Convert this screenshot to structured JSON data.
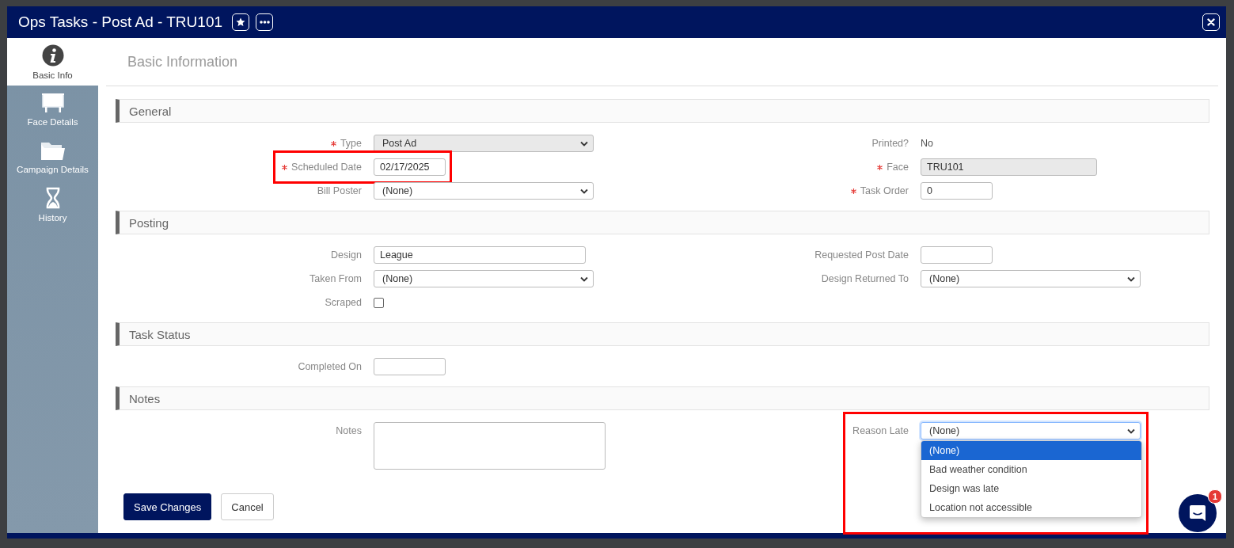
{
  "window": {
    "title": "Ops Tasks - Post Ad - TRU101"
  },
  "sidebar": {
    "items": [
      {
        "label": "Basic Info",
        "selected": true
      },
      {
        "label": "Face Details",
        "selected": false
      },
      {
        "label": "Campaign Details",
        "selected": false
      },
      {
        "label": "History",
        "selected": false
      }
    ]
  },
  "page_title": "Basic Information",
  "sections": [
    {
      "title": "General",
      "left": [
        {
          "label": "Type",
          "required": true,
          "kind": "select",
          "value": "Post Ad",
          "disabled": true
        },
        {
          "label": "Scheduled Date",
          "required": true,
          "kind": "date",
          "value": "02/17/2025",
          "highlighted": true
        },
        {
          "label": "Bill Poster",
          "required": false,
          "kind": "select",
          "value": "(None)",
          "disabled": false
        }
      ],
      "right": [
        {
          "label": "Printed?",
          "required": false,
          "kind": "plain",
          "value": "No"
        },
        {
          "label": "Face",
          "required": true,
          "kind": "readonly",
          "value": "TRU101"
        },
        {
          "label": "Task Order",
          "required": true,
          "kind": "date",
          "value": "0"
        }
      ]
    },
    {
      "title": "Posting",
      "left": [
        {
          "label": "Design",
          "required": false,
          "kind": "text",
          "value": "League"
        },
        {
          "label": "Taken From",
          "required": false,
          "kind": "select",
          "value": "(None)",
          "disabled": false
        },
        {
          "label": "Scraped",
          "required": false,
          "kind": "checkbox",
          "checked": false
        }
      ],
      "right": [
        {
          "label": "Requested Post Date",
          "required": false,
          "kind": "date"
        },
        {
          "label": "Design Returned To",
          "required": false,
          "kind": "select",
          "value": "(None)",
          "disabled": false
        }
      ]
    },
    {
      "title": "Task Status",
      "left": [
        {
          "label": "Completed On",
          "required": false,
          "kind": "date"
        }
      ]
    },
    {
      "title": "Notes",
      "left": [
        {
          "label": "Notes",
          "required": false,
          "kind": "textarea"
        }
      ],
      "right": [
        {
          "label": "Reason Late",
          "required": false,
          "kind": "select",
          "value": "(None)",
          "disabled": false,
          "highlighted": true,
          "expanded": true,
          "options": [
            {
              "label": "(None)",
              "selected": true
            },
            {
              "label": "Bad weather condition",
              "selected": false
            },
            {
              "label": "Design was late",
              "selected": false
            },
            {
              "label": "Location not accessible",
              "selected": false
            }
          ]
        }
      ]
    }
  ],
  "buttons": [
    {
      "label": "Save Changes",
      "primary": true
    },
    {
      "label": "Cancel",
      "primary": false
    }
  ],
  "chat": {
    "badge": "1"
  }
}
